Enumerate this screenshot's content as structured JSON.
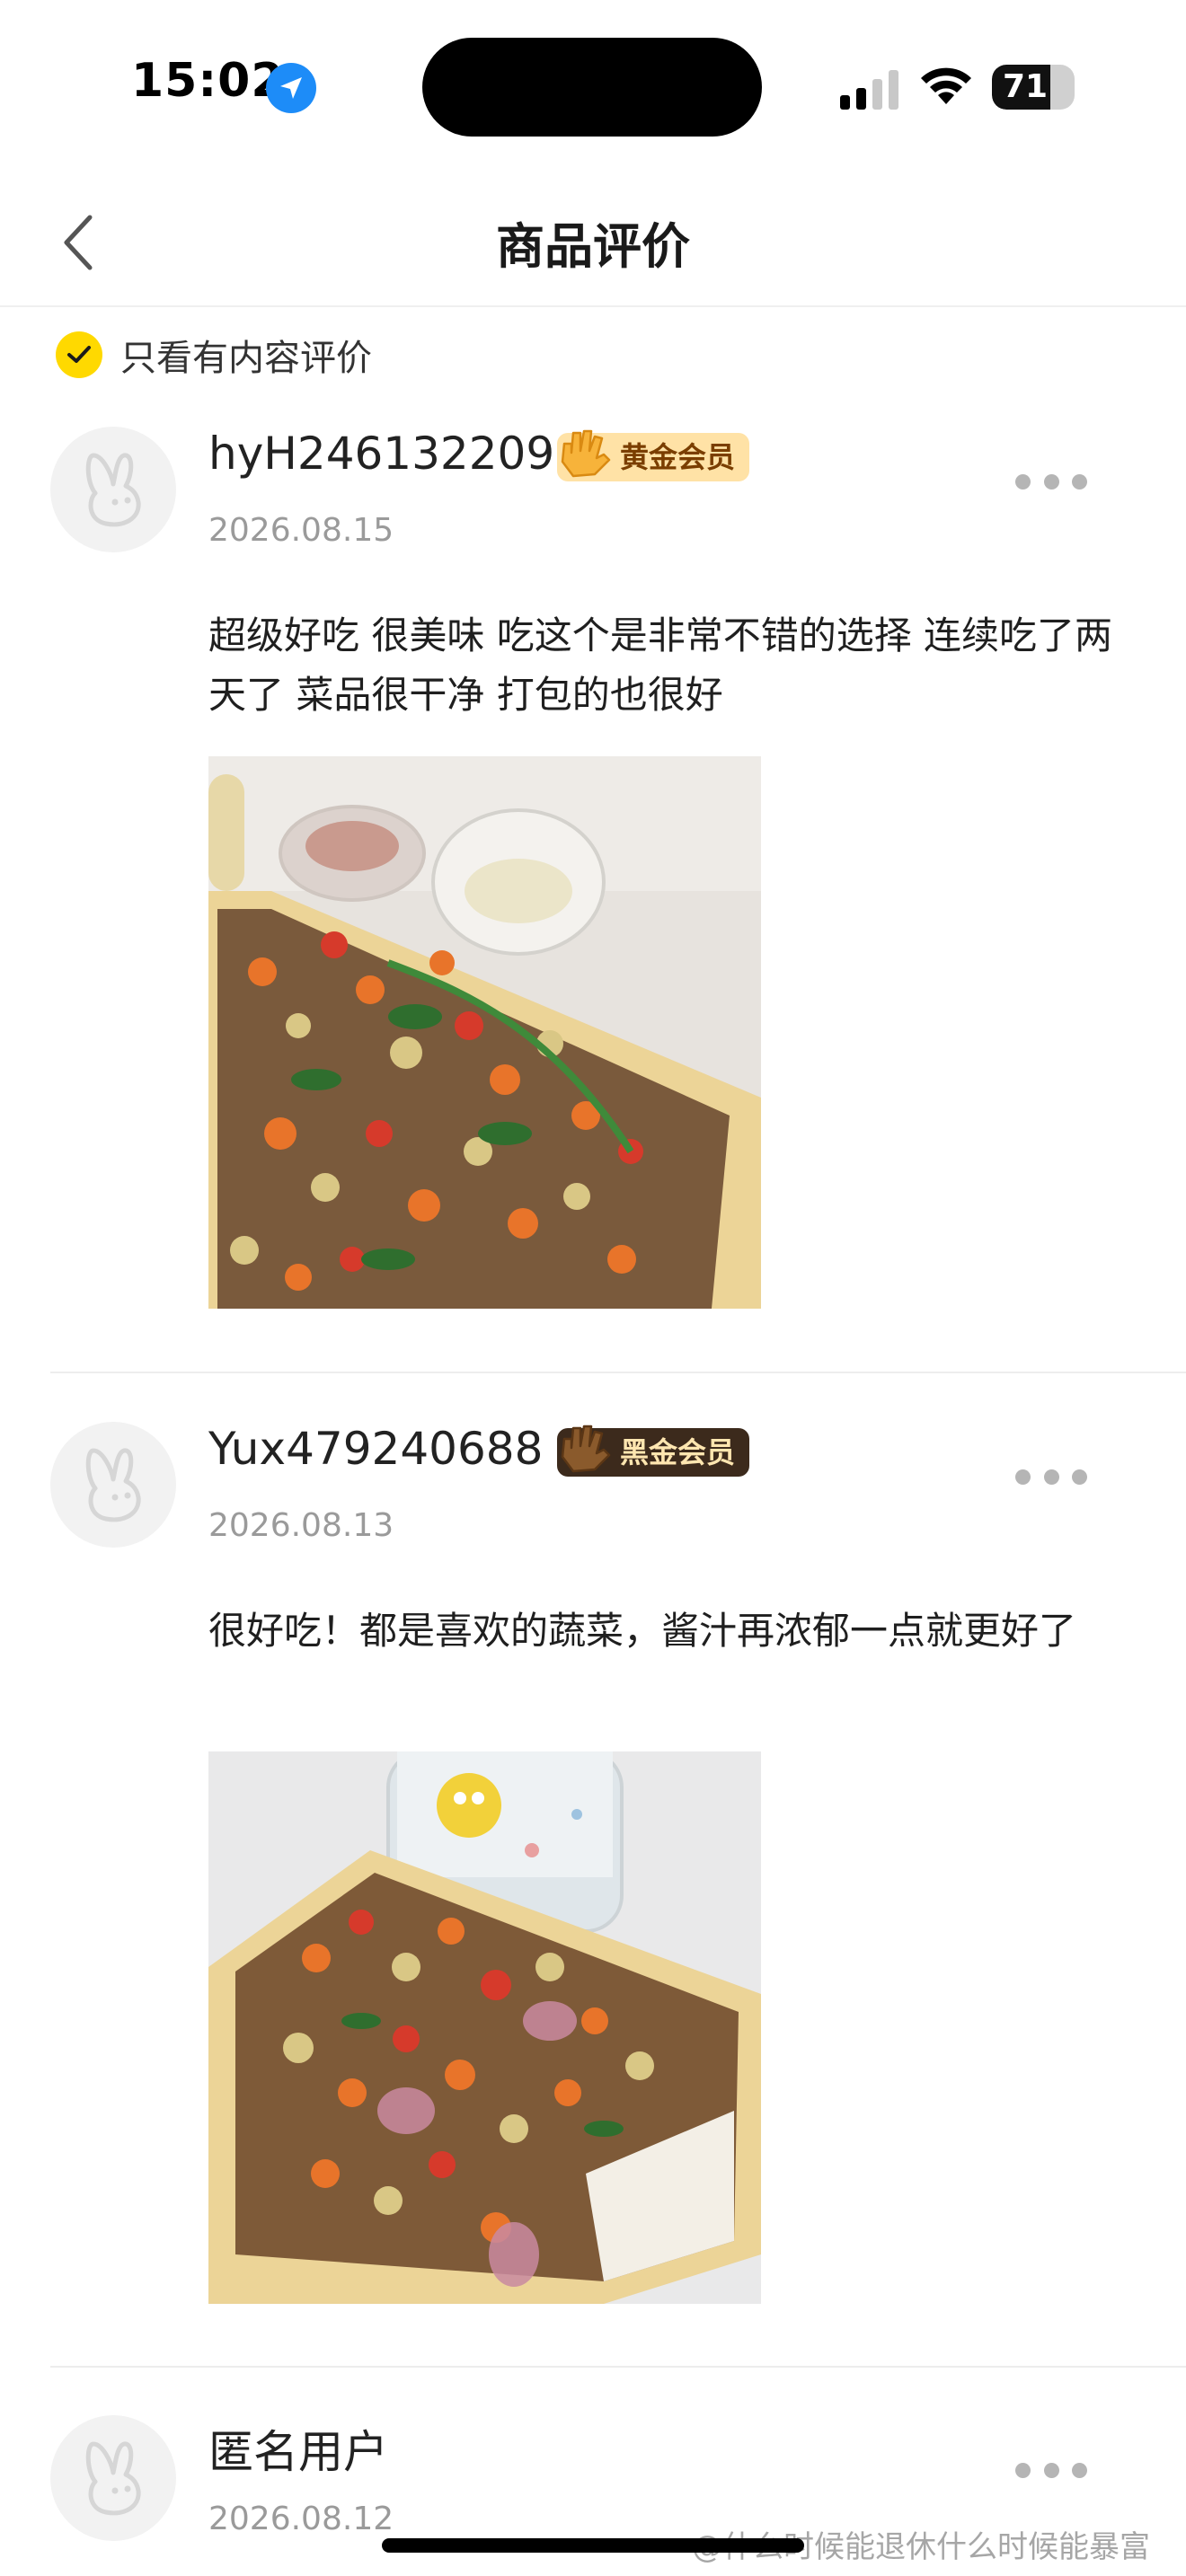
{
  "status_bar": {
    "time": "15:02",
    "battery": "71",
    "battery_level": 0.71
  },
  "nav": {
    "title": "商品评价"
  },
  "filter": {
    "label": "只看有内容评价",
    "checked": true
  },
  "reviews": [
    {
      "user": "hyH246132209",
      "badge": "黄金会员",
      "date": "2026.08.15",
      "text": "超级好吃 很美味 吃这个是非常不错的选择 连续吃了两天了 菜品很干净 打包的也很好"
    },
    {
      "user": "Yux479240688",
      "badge": "黑金会员",
      "date": "2026.08.13",
      "text": "很好吃！都是喜欢的蔬菜，酱汁再浓郁一点就更好了"
    },
    {
      "user": "匿名用户",
      "date": "2026.08.12"
    }
  ],
  "watermark": "@什么时候能退休什么时候能暴富",
  "colors": {
    "accent_yellow": "#ffd900",
    "gold_badge_bg": "#ffe2a6",
    "black_badge_bg": "#3c2a1c"
  }
}
